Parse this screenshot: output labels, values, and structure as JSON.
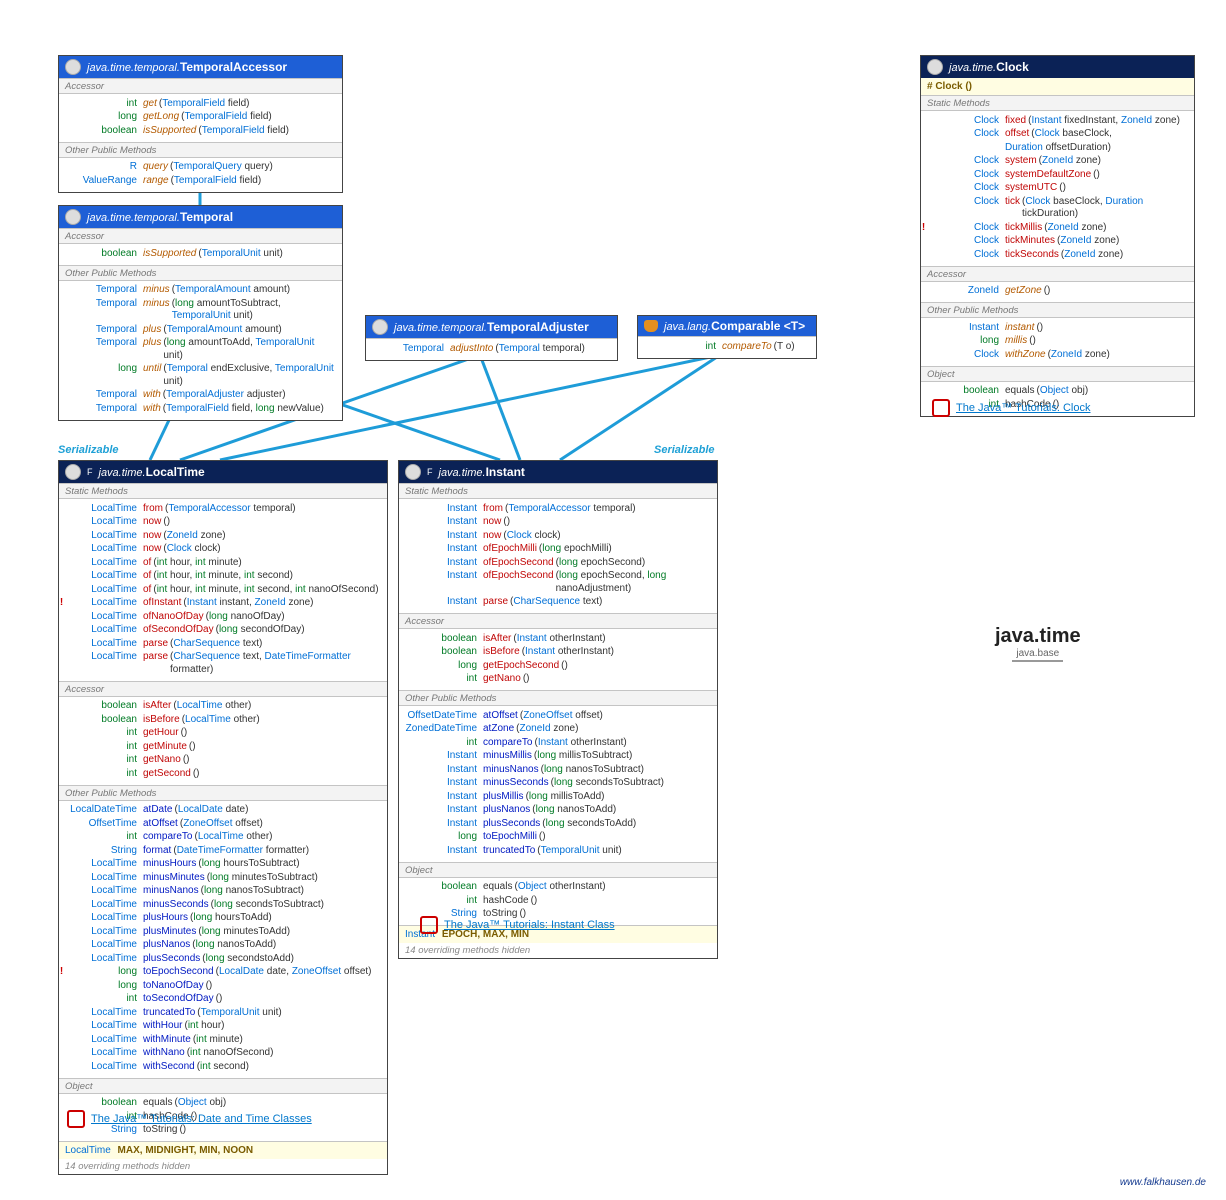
{
  "credit": "www.falkhausen.de",
  "serial1": "Serializable",
  "serial2": "Serializable",
  "ta": {
    "pkg": "java.time.temporal.",
    "cls": "TemporalAccessor",
    "sec1": "Accessor",
    "sec2": "Other Public Methods",
    "r": [
      {
        "ret": "int",
        "name": "get",
        "p": "(TemporalField field)",
        "nc": "sm"
      },
      {
        "ret": "long",
        "name": "getLong",
        "p": "(TemporalField field)",
        "nc": "sm"
      },
      {
        "ret": "boolean",
        "name": "isSupported",
        "p": "(TemporalField field)",
        "nc": "sm"
      }
    ],
    "r2": [
      {
        "ret": "<R> R",
        "name": "query",
        "p": "(TemporalQuery<R> query)",
        "nc": "sm"
      },
      {
        "ret": "ValueRange",
        "name": "range",
        "p": "(TemporalField field)",
        "nc": "sm"
      }
    ]
  },
  "temporal": {
    "pkg": "java.time.temporal.",
    "cls": "Temporal",
    "sec1": "Accessor",
    "sec2": "Other Public Methods",
    "r": [
      {
        "ret": "boolean",
        "name": "isSupported",
        "p": "(TemporalUnit unit)",
        "nc": "sm"
      }
    ],
    "r2": [
      {
        "ret": "Temporal",
        "name": "minus",
        "p": "(TemporalAmount amount)",
        "nc": "sm"
      },
      {
        "ret": "Temporal",
        "name": "minus",
        "p": "(long amountToSubtract, TemporalUnit unit)",
        "nc": "sm"
      },
      {
        "ret": "Temporal",
        "name": "plus",
        "p": "(TemporalAmount amount)",
        "nc": "sm"
      },
      {
        "ret": "Temporal",
        "name": "plus",
        "p": "(long amountToAdd, TemporalUnit unit)",
        "nc": "sm"
      },
      {
        "ret": "long",
        "name": "until",
        "p": "(Temporal endExclusive, TemporalUnit unit)",
        "nc": "sm"
      },
      {
        "ret": "Temporal",
        "name": "with",
        "p": "(TemporalAdjuster adjuster)",
        "nc": "sm"
      },
      {
        "ret": "Temporal",
        "name": "with",
        "p": "(TemporalField field, long newValue)",
        "nc": "sm"
      }
    ]
  },
  "adjuster": {
    "pkg": "java.time.temporal.",
    "cls": "TemporalAdjuster",
    "r": [
      {
        "ret": "Temporal",
        "name": "adjustInto",
        "p": "(Temporal temporal)",
        "nc": "sm"
      }
    ]
  },
  "comparable": {
    "pkg": "java.lang.",
    "cls": "Comparable <T>",
    "r": [
      {
        "ret": "int",
        "name": "compareTo",
        "p": "(T o)",
        "nc": "sm"
      }
    ]
  },
  "clock": {
    "pkg": "java.time.",
    "cls": "Clock",
    "ctor": "# Clock ()",
    "secS": "Static Methods",
    "secA": "Accessor",
    "secO": "Other Public Methods",
    "secObj": "Object",
    "s": [
      {
        "ret": "Clock",
        "name": "fixed",
        "p": "(Instant fixedInstant, ZoneId zone)"
      },
      {
        "ret": "Clock",
        "name": "offset",
        "p": "(Clock baseClock,"
      },
      {
        "ret": "",
        "name": "",
        "p": "Duration offsetDuration)"
      },
      {
        "ret": "Clock",
        "name": "system",
        "p": "(ZoneId zone)"
      },
      {
        "ret": "Clock",
        "name": "systemDefaultZone",
        "p": "()"
      },
      {
        "ret": "Clock",
        "name": "systemUTC",
        "p": "()"
      },
      {
        "ret": "Clock",
        "name": "tick",
        "p": "(Clock baseClock, Duration tickDuration)"
      },
      {
        "ret": "Clock",
        "name": "tickMillis",
        "p": "(ZoneId zone)",
        "mark": "!"
      },
      {
        "ret": "Clock",
        "name": "tickMinutes",
        "p": "(ZoneId zone)"
      },
      {
        "ret": "Clock",
        "name": "tickSeconds",
        "p": "(ZoneId zone)"
      }
    ],
    "a": [
      {
        "ret": "ZoneId",
        "name": "getZone",
        "p": "()",
        "nc": "sm"
      }
    ],
    "o": [
      {
        "ret": "Instant",
        "name": "instant",
        "p": "()",
        "nc": "sm"
      },
      {
        "ret": "long",
        "name": "millis",
        "p": "()",
        "nc": "sm"
      },
      {
        "ret": "Clock",
        "name": "withZone",
        "p": "(ZoneId zone)",
        "nc": "sm"
      }
    ],
    "obj": [
      {
        "ret": "boolean",
        "name": "equals",
        "p": "(Object obj)",
        "nc": "obj"
      },
      {
        "ret": "int",
        "name": "hashCode",
        "p": "()",
        "nc": "obj"
      }
    ],
    "link": "The Java™ Tutorials: Clock"
  },
  "localtime": {
    "pkg": "java.time.",
    "cls": "LocalTime",
    "secS": "Static Methods",
    "secA": "Accessor",
    "secO": "Other Public Methods",
    "secObj": "Object",
    "s": [
      {
        "ret": "LocalTime",
        "name": "from",
        "p": "(TemporalAccessor temporal)"
      },
      {
        "ret": "LocalTime",
        "name": "now",
        "p": "()"
      },
      {
        "ret": "LocalTime",
        "name": "now",
        "p": "(ZoneId zone)"
      },
      {
        "ret": "LocalTime",
        "name": "now",
        "p": "(Clock clock)"
      },
      {
        "ret": "LocalTime",
        "name": "of",
        "p": "(int hour, int minute)"
      },
      {
        "ret": "LocalTime",
        "name": "of",
        "p": "(int hour, int minute, int second)"
      },
      {
        "ret": "LocalTime",
        "name": "of",
        "p": "(int hour, int minute, int second, int nanoOfSecond)"
      },
      {
        "ret": "LocalTime",
        "name": "ofInstant",
        "p": "(Instant instant, ZoneId zone)",
        "mark": "!"
      },
      {
        "ret": "LocalTime",
        "name": "ofNanoOfDay",
        "p": "(long nanoOfDay)"
      },
      {
        "ret": "LocalTime",
        "name": "ofSecondOfDay",
        "p": "(long secondOfDay)"
      },
      {
        "ret": "LocalTime",
        "name": "parse",
        "p": "(CharSequence text)"
      },
      {
        "ret": "LocalTime",
        "name": "parse",
        "p": "(CharSequence text, DateTimeFormatter formatter)"
      }
    ],
    "a": [
      {
        "ret": "boolean",
        "name": "isAfter",
        "p": "(LocalTime other)"
      },
      {
        "ret": "boolean",
        "name": "isBefore",
        "p": "(LocalTime other)"
      },
      {
        "ret": "int",
        "name": "getHour",
        "p": "()"
      },
      {
        "ret": "int",
        "name": "getMinute",
        "p": "()"
      },
      {
        "ret": "int",
        "name": "getNano",
        "p": "()"
      },
      {
        "ret": "int",
        "name": "getSecond",
        "p": "()"
      }
    ],
    "o": [
      {
        "ret": "LocalDateTime",
        "name": "atDate",
        "p": "(LocalDate date)",
        "nc": "blue"
      },
      {
        "ret": "OffsetTime",
        "name": "atOffset",
        "p": "(ZoneOffset offset)",
        "nc": "blue"
      },
      {
        "ret": "int",
        "name": "compareTo",
        "p": "(LocalTime other)",
        "nc": "blue"
      },
      {
        "ret": "String",
        "name": "format",
        "p": "(DateTimeFormatter formatter)",
        "nc": "blue"
      },
      {
        "ret": "LocalTime",
        "name": "minusHours",
        "p": "(long hoursToSubtract)",
        "nc": "blue"
      },
      {
        "ret": "LocalTime",
        "name": "minusMinutes",
        "p": "(long minutesToSubtract)",
        "nc": "blue"
      },
      {
        "ret": "LocalTime",
        "name": "minusNanos",
        "p": "(long nanosToSubtract)",
        "nc": "blue"
      },
      {
        "ret": "LocalTime",
        "name": "minusSeconds",
        "p": "(long secondsToSubtract)",
        "nc": "blue"
      },
      {
        "ret": "LocalTime",
        "name": "plusHours",
        "p": "(long hoursToAdd)",
        "nc": "blue"
      },
      {
        "ret": "LocalTime",
        "name": "plusMinutes",
        "p": "(long minutesToAdd)",
        "nc": "blue"
      },
      {
        "ret": "LocalTime",
        "name": "plusNanos",
        "p": "(long nanosToAdd)",
        "nc": "blue"
      },
      {
        "ret": "LocalTime",
        "name": "plusSeconds",
        "p": "(long secondstoAdd)",
        "nc": "blue"
      },
      {
        "ret": "long",
        "name": "toEpochSecond",
        "p": "(LocalDate date, ZoneOffset offset)",
        "nc": "blue",
        "mark": "!"
      },
      {
        "ret": "long",
        "name": "toNanoOfDay",
        "p": "()",
        "nc": "blue"
      },
      {
        "ret": "int",
        "name": "toSecondOfDay",
        "p": "()",
        "nc": "blue"
      },
      {
        "ret": "LocalTime",
        "name": "truncatedTo",
        "p": "(TemporalUnit unit)",
        "nc": "blue"
      },
      {
        "ret": "LocalTime",
        "name": "withHour",
        "p": "(int hour)",
        "nc": "blue"
      },
      {
        "ret": "LocalTime",
        "name": "withMinute",
        "p": "(int minute)",
        "nc": "blue"
      },
      {
        "ret": "LocalTime",
        "name": "withNano",
        "p": "(int nanoOfSecond)",
        "nc": "blue"
      },
      {
        "ret": "LocalTime",
        "name": "withSecond",
        "p": "(int second)",
        "nc": "blue"
      }
    ],
    "obj": [
      {
        "ret": "boolean",
        "name": "equals",
        "p": "(Object obj)",
        "nc": "obj"
      },
      {
        "ret": "int",
        "name": "hashCode",
        "p": "()",
        "nc": "obj"
      },
      {
        "ret": "String",
        "name": "toString",
        "p": "()",
        "nc": "obj"
      }
    ],
    "consts": {
      "ret": "LocalTime",
      "vals": "MAX, MIDNIGHT, MIN, NOON"
    },
    "footer": "14 overriding methods hidden",
    "link": "The Java™ Tutorials: Date and Time Classes"
  },
  "instant": {
    "pkg": "java.time.",
    "cls": "Instant",
    "secS": "Static Methods",
    "secA": "Accessor",
    "secO": "Other Public Methods",
    "secObj": "Object",
    "s": [
      {
        "ret": "Instant",
        "name": "from",
        "p": "(TemporalAccessor temporal)"
      },
      {
        "ret": "Instant",
        "name": "now",
        "p": "()"
      },
      {
        "ret": "Instant",
        "name": "now",
        "p": "(Clock clock)"
      },
      {
        "ret": "Instant",
        "name": "ofEpochMilli",
        "p": "(long epochMilli)"
      },
      {
        "ret": "Instant",
        "name": "ofEpochSecond",
        "p": "(long epochSecond)"
      },
      {
        "ret": "Instant",
        "name": "ofEpochSecond",
        "p": "(long epochSecond, long nanoAdjustment)"
      },
      {
        "ret": "Instant",
        "name": "parse",
        "p": "(CharSequence text)"
      }
    ],
    "a": [
      {
        "ret": "boolean",
        "name": "isAfter",
        "p": "(Instant otherInstant)"
      },
      {
        "ret": "boolean",
        "name": "isBefore",
        "p": "(Instant otherInstant)"
      },
      {
        "ret": "long",
        "name": "getEpochSecond",
        "p": "()"
      },
      {
        "ret": "int",
        "name": "getNano",
        "p": "()"
      }
    ],
    "o": [
      {
        "ret": "OffsetDateTime",
        "name": "atOffset",
        "p": "(ZoneOffset offset)",
        "nc": "blue"
      },
      {
        "ret": "ZonedDateTime",
        "name": "atZone",
        "p": "(ZoneId zone)",
        "nc": "blue"
      },
      {
        "ret": "int",
        "name": "compareTo",
        "p": "(Instant otherInstant)",
        "nc": "blue"
      },
      {
        "ret": "Instant",
        "name": "minusMillis",
        "p": "(long millisToSubtract)",
        "nc": "blue"
      },
      {
        "ret": "Instant",
        "name": "minusNanos",
        "p": "(long nanosToSubtract)",
        "nc": "blue"
      },
      {
        "ret": "Instant",
        "name": "minusSeconds",
        "p": "(long secondsToSubtract)",
        "nc": "blue"
      },
      {
        "ret": "Instant",
        "name": "plusMillis",
        "p": "(long millisToAdd)",
        "nc": "blue"
      },
      {
        "ret": "Instant",
        "name": "plusNanos",
        "p": "(long nanosToAdd)",
        "nc": "blue"
      },
      {
        "ret": "Instant",
        "name": "plusSeconds",
        "p": "(long secondsToAdd)",
        "nc": "blue"
      },
      {
        "ret": "long",
        "name": "toEpochMilli",
        "p": "()",
        "nc": "blue"
      },
      {
        "ret": "Instant",
        "name": "truncatedTo",
        "p": "(TemporalUnit unit)",
        "nc": "blue"
      }
    ],
    "obj": [
      {
        "ret": "boolean",
        "name": "equals",
        "p": "(Object otherInstant)",
        "nc": "obj"
      },
      {
        "ret": "int",
        "name": "hashCode",
        "p": "()",
        "nc": "obj"
      },
      {
        "ret": "String",
        "name": "toString",
        "p": "()",
        "nc": "obj"
      }
    ],
    "consts": {
      "ret": "Instant",
      "vals": "EPOCH, MAX, MIN"
    },
    "footer": "14 overriding methods hidden",
    "link": "The Java™ Tutorials: Instant Class"
  },
  "modbadge": {
    "t1": "java.time",
    "t2": "java.base"
  }
}
